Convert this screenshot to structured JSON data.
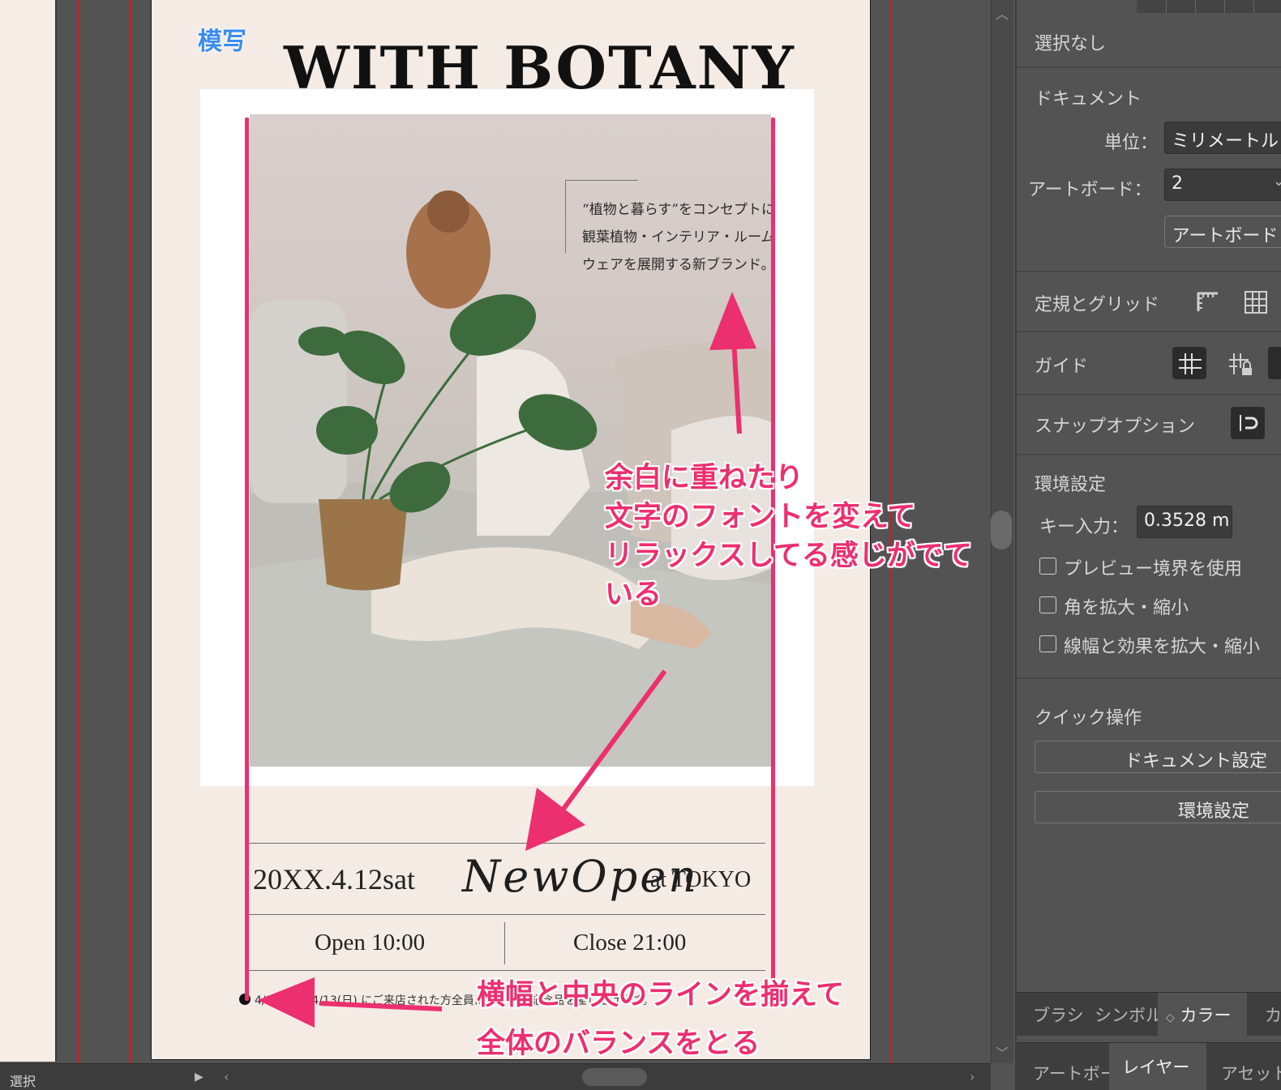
{
  "canvas": {
    "badge": "模写",
    "brand_title": "WITH BOTANY",
    "concept_lines": [
      "“植物と暮らす”をコンセプトに",
      "観葉植物・インテリア・ルーム",
      "ウェアを展開する新ブランド。"
    ],
    "date": "20XX.4.12sat",
    "new_open": "NewOpen",
    "location": "at TOKYO",
    "open_time": "Open 10:00",
    "close_time": "Close 21:00",
    "notice": "4/12(土)〜4/13(日) にご来店された方全員にオープン記念品を差し上げます。",
    "annotations": {
      "relax": [
        "余白に重ねたり",
        "文字のフォントを変えて",
        "リラックスしてる感じがでて",
        "いる"
      ],
      "balance": [
        "横幅と中央のラインを揃えて",
        "全体のバランスをとる"
      ]
    }
  },
  "statusbar": {
    "tool": "選択"
  },
  "panel": {
    "selection": "選択なし",
    "document_heading": "ドキュメント",
    "unit_label": "単位：",
    "unit_value": "ミリメートル",
    "artboard_label": "アートボード：",
    "artboard_value": "2",
    "artboard_button": "アートボード",
    "rulers_grids": "定規とグリッド",
    "guides": "ガイド",
    "snap_options": "スナップオプション",
    "preferences": "環境設定",
    "key_input_label": "キー入力：",
    "key_input_value": "0.3528 m",
    "checkboxes": [
      "プレビュー境界を使用",
      "角を拡大・縮小",
      "線幅と効果を拡大・縮小"
    ],
    "quick_actions": "クイック操作",
    "doc_setup_button": "ドキュメント設定",
    "prefs_button": "環境設定",
    "tabs_row1": [
      "ブラシ",
      "シンボル",
      "カラー",
      "カ"
    ],
    "tabs_row2": [
      "アートボード",
      "レイヤー",
      "アセット"
    ]
  },
  "colors": {
    "accent_pink": "#ec2f6f",
    "badge_blue": "#3b8cec",
    "guide_red": "#c8202a",
    "artboard_bg": "#f4ebe5"
  }
}
